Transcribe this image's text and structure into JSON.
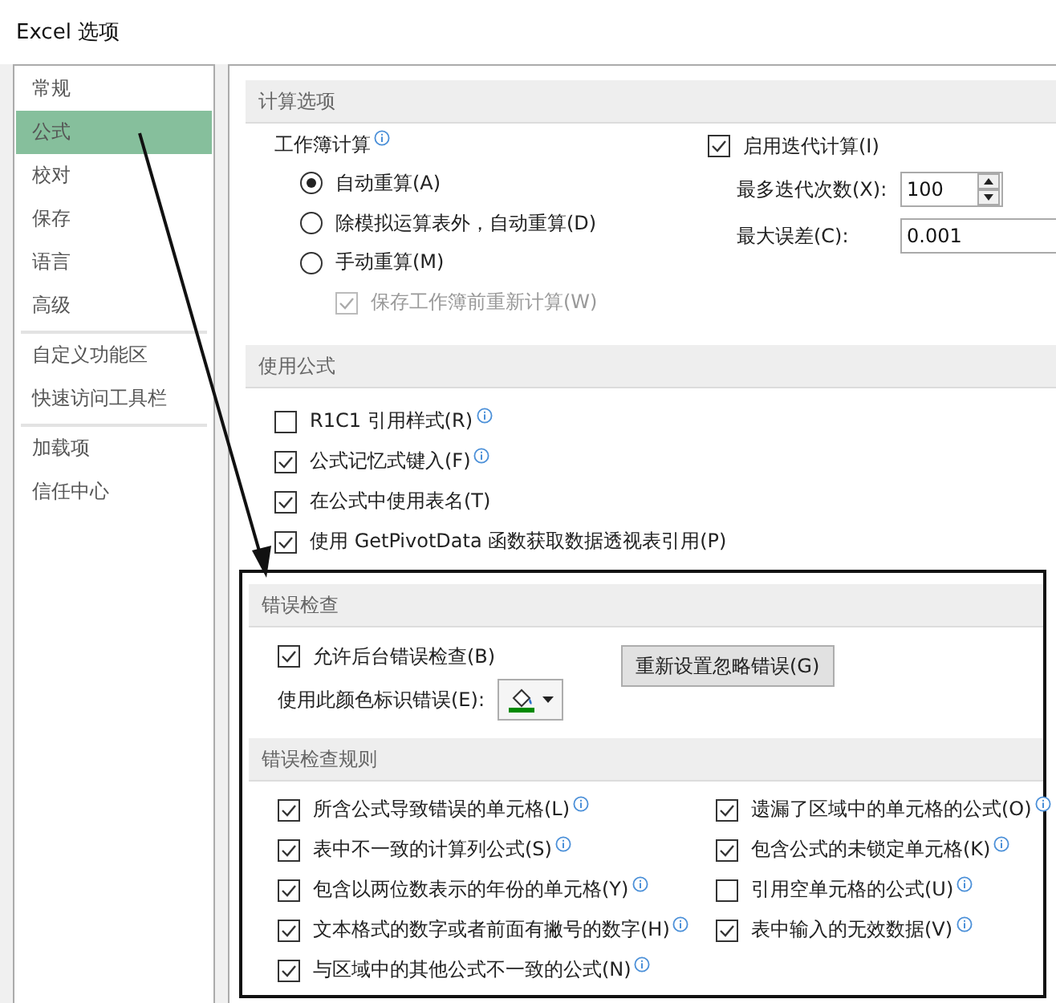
{
  "window": {
    "title": "Excel 选项"
  },
  "sidebar": {
    "groups": [
      [
        {
          "label": "常规",
          "selected": false
        },
        {
          "label": "公式",
          "selected": true
        },
        {
          "label": "校对",
          "selected": false
        },
        {
          "label": "保存",
          "selected": false
        },
        {
          "label": "语言",
          "selected": false
        },
        {
          "label": "高级",
          "selected": false
        }
      ],
      [
        {
          "label": "自定义功能区",
          "selected": false
        },
        {
          "label": "快速访问工具栏",
          "selected": false
        }
      ],
      [
        {
          "label": "加载项",
          "selected": false
        },
        {
          "label": "信任中心",
          "selected": false
        }
      ]
    ]
  },
  "calculation": {
    "title": "计算选项",
    "workbook_label": "工作簿计算",
    "workbook_info": true,
    "modes": [
      {
        "label": "自动重算(A)",
        "selected": true
      },
      {
        "label": "除模拟运算表外，自动重算(D)",
        "selected": false
      },
      {
        "label": "手动重算(M)",
        "selected": false
      }
    ],
    "recalc_before_save": {
      "label": "保存工作簿前重新计算(W)",
      "checked": true,
      "disabled": true
    },
    "iterative": {
      "label": "启用迭代计算(I)",
      "checked": true
    },
    "max_iterations": {
      "label": "最多迭代次数(X):",
      "value": "100"
    },
    "max_change": {
      "label": "最大误差(C):",
      "value": "0.001"
    }
  },
  "formulas": {
    "title": "使用公式",
    "options": [
      {
        "label": "R1C1 引用样式(R)",
        "checked": false,
        "info": true
      },
      {
        "label": "公式记忆式键入(F)",
        "checked": true,
        "info": true
      },
      {
        "label": "在公式中使用表名(T)",
        "checked": true,
        "info": false
      },
      {
        "label": "使用 GetPivotData 函数获取数据透视表引用(P)",
        "checked": true,
        "info": false
      }
    ]
  },
  "error_checking": {
    "title": "错误检查",
    "background": {
      "label": "允许后台错误检查(B)",
      "checked": true
    },
    "color_label": "使用此颜色标识错误(E):",
    "color": "#008a00",
    "reset_button": "重新设置忽略错误(G)"
  },
  "error_rules": {
    "title": "错误检查规则",
    "left": [
      {
        "label": "所含公式导致错误的单元格(L)",
        "checked": true,
        "info": true
      },
      {
        "label": "表中不一致的计算列公式(S)",
        "checked": true,
        "info": true
      },
      {
        "label": "包含以两位数表示的年份的单元格(Y)",
        "checked": true,
        "info": true
      },
      {
        "label": "文本格式的数字或者前面有撇号的数字(H)",
        "checked": true,
        "info": true
      },
      {
        "label": "与区域中的其他公式不一致的公式(N)",
        "checked": true,
        "info": true
      }
    ],
    "right": [
      {
        "label": "遗漏了区域中的单元格的公式(O)",
        "checked": true,
        "info": true
      },
      {
        "label": "包含公式的未锁定单元格(K)",
        "checked": true,
        "info": true
      },
      {
        "label": "引用空单元格的公式(U)",
        "checked": false,
        "info": true
      },
      {
        "label": "表中输入的无效数据(V)",
        "checked": true,
        "info": true
      }
    ]
  }
}
